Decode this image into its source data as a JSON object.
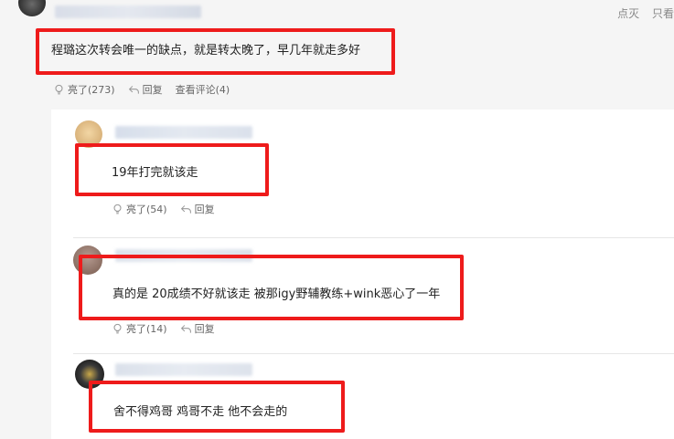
{
  "top_actions": [
    "点灭",
    "只看"
  ],
  "main_comment": {
    "text": "程璐这次转会唯一的缺点，就是转太晚了，早几年就走多好",
    "like_label": "亮了(273)",
    "reply_label": "回复",
    "view_comments_label": "查看评论(4)"
  },
  "replies": [
    {
      "text": "19年打完就该走",
      "like_label": "亮了(54)",
      "reply_label": "回复"
    },
    {
      "text": "真的是 20成绩不好就该走 被那igy野辅教练+wink恶心了一年",
      "like_label": "亮了(14)",
      "reply_label": "回复"
    },
    {
      "text": "舍不得鸡哥 鸡哥不走 他不会走的"
    }
  ],
  "colors": {
    "highlight": "#ee1b1b",
    "background": "#f5f5f5",
    "panel": "#ffffff"
  }
}
